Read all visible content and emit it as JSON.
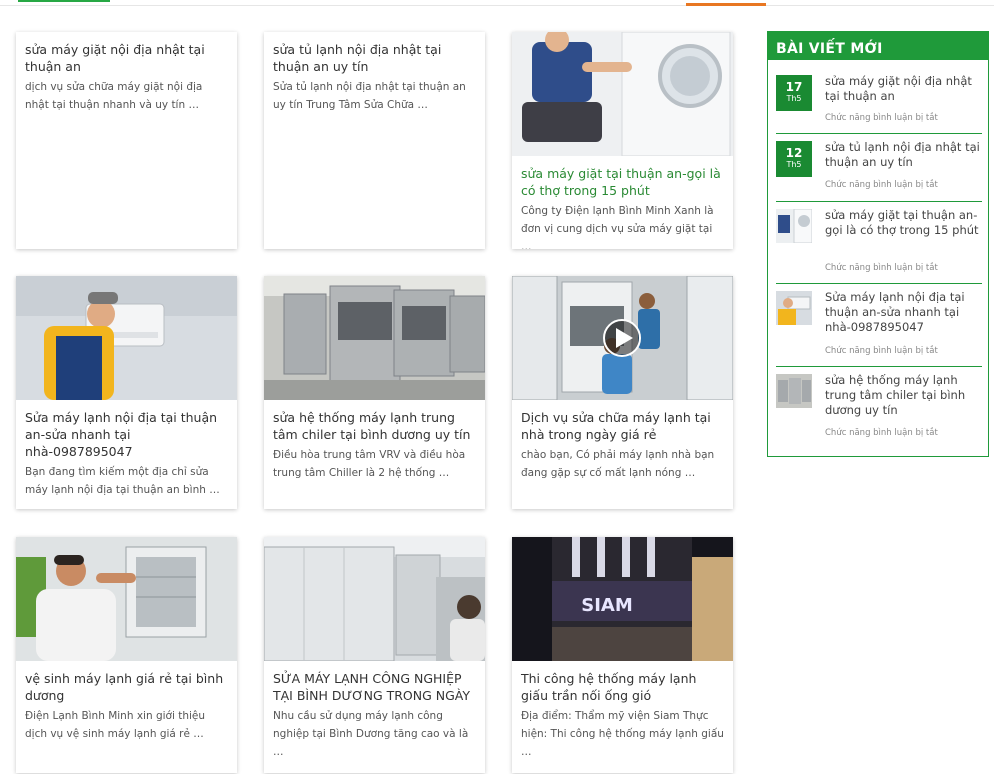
{
  "colors": {
    "accent_orange": "#e87722",
    "brand_green": "#1f9a3a",
    "title_green": "#2a8a34"
  },
  "posts": [
    {
      "title": "sửa máy giặt nội địa nhật tại thuận an",
      "excerpt": "dịch vụ sửa chữa máy giặt nội địa nhật tại thuận nhanh và uy tín …",
      "image": "none"
    },
    {
      "title": "sửa tủ lạnh nội địa nhật tại thuận an uy tín",
      "excerpt": "Sửa tủ lạnh nội địa nhật tại thuận an uy tín Trung Tâm Sửa Chữa …",
      "image": "none"
    },
    {
      "title": "sửa máy giặt tại thuận an-gọi là có thợ trong 15 phút",
      "excerpt": "Công ty Điện lạnh Bình Minh Xanh là đơn vị cung dịch vụ sửa máy giặt tại …",
      "image": "washing-machine-repair-photo",
      "title_color": "green"
    },
    {
      "title": "Sửa máy lạnh nội địa tại thuận an-sửa nhanh tại nhà-0987895047",
      "excerpt": "Bạn đang tìm kiếm một địa chỉ sửa máy lạnh nội địa tại thuận an bình …",
      "image": "ac-technician-photo"
    },
    {
      "title": "sửa hệ thống máy lạnh trung tâm chiler tại bình dương uy tín",
      "excerpt": "Điều hòa trung tâm VRV và điều hòa trung tâm Chiller là 2 hệ thống …",
      "image": "rooftop-ac-units-photo"
    },
    {
      "title": "Dịch vụ sửa chữa máy lạnh tại nhà trong ngày giá rẻ",
      "excerpt": "chào bạn, Có phải máy lạnh nhà bạn đang gặp sự cố mất lạnh nóng …",
      "image": "vrv-units-technicians-video"
    },
    {
      "title": "vệ sinh máy lạnh giá rẻ tại bình dương",
      "excerpt": "Điện Lạnh Bình Minh xin giới thiệu dịch vụ vệ sinh  máy lạnh giá rẻ …",
      "image": "ac-cleaning-photo"
    },
    {
      "title": "SỬA MÁY LẠNH CÔNG NGHIỆP TẠI BÌNH DƯƠNG TRONG NGÀY",
      "excerpt": "Nhu cầu sử dụng máy lạnh công nghiệp tại Bình Dương tăng cao và là …",
      "image": "industrial-ac-photo"
    },
    {
      "title": "Thi công hệ thống máy lạnh giấu trần nối ống gió",
      "excerpt": "Địa điểm: Thẩm mỹ viện Siam Thực hiện: Thi công hệ thống máy lạnh giấu …",
      "image": "siam-building-photo",
      "sign": "SIAM"
    }
  ],
  "sidebar": {
    "heading": "BÀI VIẾT MỚI",
    "items": [
      {
        "day": "17",
        "month": "Th5",
        "title": "sửa máy giặt nội địa nhật tại thuận an",
        "meta": "Chức năng bình luận bị tắt"
      },
      {
        "day": "12",
        "month": "Th5",
        "title": "sửa tủ lạnh nội địa nhật tại thuận an uy tín",
        "meta": "Chức năng bình luận bị tắt"
      },
      {
        "title": "sửa máy giặt tại thuận an-gọi là có thợ trong 15 phút",
        "meta": "Chức năng bình luận bị tắt",
        "thumb": "washing-machine-repair-thumb"
      },
      {
        "title": "Sửa máy lạnh nội địa tại thuận an-sửa nhanh tại nhà-0987895047",
        "meta": "Chức năng bình luận bị tắt",
        "thumb": "ac-technician-thumb"
      },
      {
        "title": "sửa hệ thống máy lạnh trung tâm chiler tại bình dương uy tín",
        "meta": "Chức năng bình luận bị tắt",
        "thumb": "rooftop-ac-thumb"
      }
    ]
  }
}
